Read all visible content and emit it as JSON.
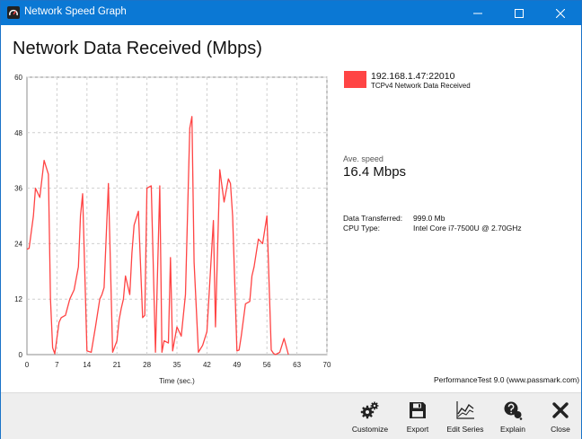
{
  "window": {
    "title": "Network Speed Graph",
    "icon": "speedometer-icon",
    "controls": [
      "minimize-icon",
      "maximize-icon",
      "close-icon"
    ]
  },
  "heading": "Network Data Received (Mbps)",
  "legend": {
    "host": "192.168.1.47:22010",
    "description": "TCPv4 Network Data Received",
    "color": "#ff4444"
  },
  "stats": {
    "ave_label": "Ave. speed",
    "ave_value": "16.4 Mbps",
    "data_transferred_label": "Data Transferred:",
    "data_transferred_value": "999.0 Mb",
    "cpu_label": "CPU Type:",
    "cpu_value": "Intel Core i7-7500U @ 2.70GHz"
  },
  "credit": "PerformanceTest 9.0 (www.passmark.com)",
  "toolbar": [
    {
      "label": "Customize",
      "icon": "gears-icon"
    },
    {
      "label": "Export",
      "icon": "floppy-disk-icon"
    },
    {
      "label": "Edit Series",
      "icon": "line-chart-icon"
    },
    {
      "label": "Explain",
      "icon": "help-bubble-icon"
    },
    {
      "label": "Close",
      "icon": "x-icon"
    }
  ],
  "chart_data": {
    "type": "line",
    "title": "",
    "xlabel": "Time (sec.)",
    "ylabel": "",
    "xlim": [
      0,
      70
    ],
    "ylim": [
      0,
      60
    ],
    "x_ticks": [
      0,
      7,
      14,
      21,
      28,
      35,
      42,
      49,
      56,
      63,
      70
    ],
    "y_ticks": [
      0,
      12,
      24,
      36,
      48,
      60
    ],
    "grid": true,
    "series": [
      {
        "name": "192.168.1.47:22010",
        "color": "#ff4444",
        "x": [
          0,
          0.5,
          1.5,
          2,
          3,
          4,
          5,
          5.5,
          6,
          6.5,
          7.5,
          8,
          9,
          10,
          11,
          12,
          12.5,
          13,
          14,
          15,
          16,
          17,
          17.5,
          18,
          19,
          20,
          21,
          21.5,
          22,
          22.5,
          23,
          24,
          24.5,
          25,
          26,
          27,
          27.5,
          28,
          29,
          30,
          31,
          31.5,
          32,
          33,
          33.5,
          34,
          35,
          36,
          37,
          38,
          38.5,
          39,
          40,
          41,
          42,
          43,
          43.5,
          44,
          45,
          46,
          47,
          47.5,
          48,
          49,
          49.5,
          50,
          51,
          52,
          52.5,
          53,
          54,
          55,
          56,
          57,
          57.5,
          58,
          59,
          60,
          61
        ],
        "values": [
          22.8,
          23,
          30,
          36,
          34,
          42,
          39,
          12,
          1.5,
          0.2,
          7,
          8,
          8.5,
          12,
          14,
          19,
          30,
          34.8,
          0.8,
          0.5,
          6,
          12,
          13,
          14.5,
          37,
          0.5,
          3,
          7.5,
          10,
          12,
          17,
          13,
          22,
          28,
          31,
          8,
          8.5,
          36,
          36.5,
          0.5,
          36.5,
          0.5,
          3,
          2.5,
          21,
          0.8,
          6,
          4,
          13,
          49,
          51.5,
          20,
          0.5,
          2,
          5,
          21,
          29,
          6,
          40,
          33,
          38,
          37,
          30,
          0.8,
          1,
          4,
          11,
          11.5,
          17,
          19,
          25,
          24,
          30,
          1,
          0.3,
          0,
          0.5,
          3.5,
          0
        ]
      }
    ]
  }
}
